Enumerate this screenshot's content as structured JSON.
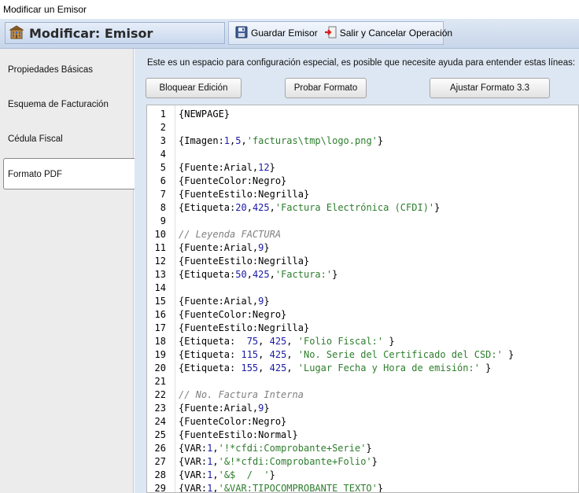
{
  "window": {
    "title": "Modificar un Emisor"
  },
  "toolbar": {
    "module_title": "Modificar: Emisor",
    "save_label": "Guardar Emisor",
    "cancel_label": "Salir y Cancelar Operación"
  },
  "sidebar": {
    "items": [
      {
        "label": "Propiedades Básicas",
        "active": false
      },
      {
        "label": "Esquema de Facturación",
        "active": false
      },
      {
        "label": "Cédula Fiscal",
        "active": false
      },
      {
        "label": "Formato PDF",
        "active": true
      }
    ]
  },
  "main": {
    "info_text": "Este es un espacio para configuración especial, es posible que necesite ayuda para entender estas líneas:",
    "buttons": {
      "lock": "Bloquear Edición",
      "test": "Probar Formato",
      "adjust": "Ajustar Formato 3.3"
    }
  },
  "editor": {
    "lines": [
      {
        "n": "1",
        "segs": [
          [
            "{NEWPAGE}",
            "p"
          ]
        ]
      },
      {
        "n": "2",
        "segs": []
      },
      {
        "n": "3",
        "segs": [
          [
            "{Imagen:",
            "p"
          ],
          [
            "1",
            "n"
          ],
          [
            ",",
            "p"
          ],
          [
            "5",
            "n"
          ],
          [
            ",",
            "p"
          ],
          [
            "'facturas\\tmp\\logo.png'",
            "s"
          ],
          [
            "}",
            "p"
          ]
        ]
      },
      {
        "n": "4",
        "segs": []
      },
      {
        "n": "5",
        "segs": [
          [
            "{Fuente:Arial,",
            "p"
          ],
          [
            "12",
            "n"
          ],
          [
            "}",
            "p"
          ]
        ]
      },
      {
        "n": "6",
        "segs": [
          [
            "{FuenteColor:Negro}",
            "p"
          ]
        ]
      },
      {
        "n": "7",
        "segs": [
          [
            "{FuenteEstilo:Negrilla}",
            "p"
          ]
        ]
      },
      {
        "n": "8",
        "segs": [
          [
            "{Etiqueta:",
            "p"
          ],
          [
            "20",
            "n"
          ],
          [
            ",",
            "p"
          ],
          [
            "425",
            "n"
          ],
          [
            ",",
            "p"
          ],
          [
            "'Factura Electrónica (CFDI)'",
            "s"
          ],
          [
            "}",
            "p"
          ]
        ]
      },
      {
        "n": "9",
        "segs": []
      },
      {
        "n": "10",
        "segs": [
          [
            "// Leyenda FACTURA",
            "c"
          ]
        ]
      },
      {
        "n": "11",
        "segs": [
          [
            "{Fuente:Arial,",
            "p"
          ],
          [
            "9",
            "n"
          ],
          [
            "}",
            "p"
          ]
        ]
      },
      {
        "n": "12",
        "segs": [
          [
            "{FuenteEstilo:Negrilla}",
            "p"
          ]
        ]
      },
      {
        "n": "13",
        "segs": [
          [
            "{Etiqueta:",
            "p"
          ],
          [
            "50",
            "n"
          ],
          [
            ",",
            "p"
          ],
          [
            "425",
            "n"
          ],
          [
            ",",
            "p"
          ],
          [
            "'Factura:'",
            "s"
          ],
          [
            "}",
            "p"
          ]
        ]
      },
      {
        "n": "14",
        "segs": []
      },
      {
        "n": "15",
        "segs": [
          [
            "{Fuente:Arial,",
            "p"
          ],
          [
            "9",
            "n"
          ],
          [
            "}",
            "p"
          ]
        ]
      },
      {
        "n": "16",
        "segs": [
          [
            "{FuenteColor:Negro}",
            "p"
          ]
        ]
      },
      {
        "n": "17",
        "segs": [
          [
            "{FuenteEstilo:Negrilla}",
            "p"
          ]
        ]
      },
      {
        "n": "18",
        "segs": [
          [
            "{Etiqueta:  ",
            "p"
          ],
          [
            "75",
            "n"
          ],
          [
            ", ",
            "p"
          ],
          [
            "425",
            "n"
          ],
          [
            ", ",
            "p"
          ],
          [
            "'Folio Fiscal:'",
            "s"
          ],
          [
            " }",
            "p"
          ]
        ]
      },
      {
        "n": "19",
        "segs": [
          [
            "{Etiqueta: ",
            "p"
          ],
          [
            "115",
            "n"
          ],
          [
            ", ",
            "p"
          ],
          [
            "425",
            "n"
          ],
          [
            ", ",
            "p"
          ],
          [
            "'No. Serie del Certificado del CSD:'",
            "s"
          ],
          [
            " }",
            "p"
          ]
        ]
      },
      {
        "n": "20",
        "segs": [
          [
            "{Etiqueta: ",
            "p"
          ],
          [
            "155",
            "n"
          ],
          [
            ", ",
            "p"
          ],
          [
            "425",
            "n"
          ],
          [
            ", ",
            "p"
          ],
          [
            "'Lugar Fecha y Hora de emisión:'",
            "s"
          ],
          [
            " }",
            "p"
          ]
        ]
      },
      {
        "n": "21",
        "segs": []
      },
      {
        "n": "22",
        "segs": [
          [
            "// No. Factura Interna",
            "c"
          ]
        ]
      },
      {
        "n": "23",
        "segs": [
          [
            "{Fuente:Arial,",
            "p"
          ],
          [
            "9",
            "n"
          ],
          [
            "}",
            "p"
          ]
        ]
      },
      {
        "n": "24",
        "segs": [
          [
            "{FuenteColor:Negro}",
            "p"
          ]
        ]
      },
      {
        "n": "25",
        "segs": [
          [
            "{FuenteEstilo:Normal}",
            "p"
          ]
        ]
      },
      {
        "n": "26",
        "segs": [
          [
            "{VAR:",
            "p"
          ],
          [
            "1",
            "n"
          ],
          [
            ",",
            "p"
          ],
          [
            "'!*cfdi:Comprobante+Serie'",
            "s"
          ],
          [
            "}",
            "p"
          ]
        ]
      },
      {
        "n": "27",
        "segs": [
          [
            "{VAR:",
            "p"
          ],
          [
            "1",
            "n"
          ],
          [
            ",",
            "p"
          ],
          [
            "'&!*cfdi:Comprobante+Folio'",
            "s"
          ],
          [
            "}",
            "p"
          ]
        ]
      },
      {
        "n": "28",
        "segs": [
          [
            "{VAR:",
            "p"
          ],
          [
            "1",
            "n"
          ],
          [
            ",",
            "p"
          ],
          [
            "'&$  /  '",
            "s"
          ],
          [
            "}",
            "p"
          ]
        ]
      },
      {
        "n": "29",
        "segs": [
          [
            "{VAR:",
            "p"
          ],
          [
            "1",
            "n"
          ],
          [
            ",",
            "p"
          ],
          [
            "'&VAR:TIPOCOMPROBANTE_TEXTO'",
            "s"
          ],
          [
            "}",
            "p"
          ]
        ]
      }
    ]
  }
}
